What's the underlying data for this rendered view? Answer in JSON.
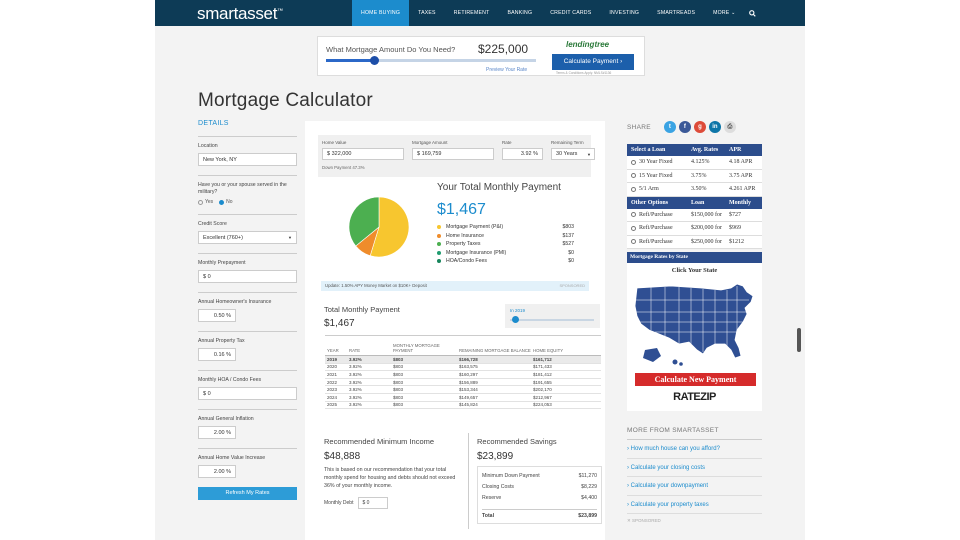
{
  "header": {
    "logo": "smartasset",
    "nav": [
      "HOME BUYING",
      "TAXES",
      "RETIREMENT",
      "BANKING",
      "CREDIT CARDS",
      "INVESTING",
      "SMARTREADS",
      "MORE ⌄"
    ],
    "active_nav": "HOME BUYING"
  },
  "ad": {
    "question": "What Mortgage Amount Do You Need?",
    "amount": "$225,000",
    "preview": "Preview Your Rate",
    "brand": "lendingtree",
    "button": "Calculate Payment ›",
    "fine_print": "Terms & Conditions Apply. NMLS#1136"
  },
  "page_title": "Mortgage Calculator",
  "sidebar": {
    "details": "DETAILS",
    "location_label": "Location",
    "location_value": "New York, NY",
    "military_label": "Have you or your spouse served in the military?",
    "military_yes": "Yes",
    "military_no": "No",
    "credit_label": "Credit Score",
    "credit_value": "Excellent (760+)",
    "prepay_label": "Monthly Prepayment",
    "prepay_value": "$ 0",
    "insurance_label": "Annual Homeowner's Insurance",
    "insurance_value": "0.50 %",
    "tax_label": "Annual Property Tax",
    "tax_value": "0.16 %",
    "hoa_label": "Monthly HOA / Condo Fees",
    "hoa_value": "$ 0",
    "inflation_label": "Annual General Inflation",
    "inflation_value": "2.00 %",
    "hvi_label": "Annual Home Value Increase",
    "hvi_value": "2.00 %",
    "refresh": "Refresh My Rates"
  },
  "inputs": {
    "home_value_label": "Home Value",
    "home_value": "$ 322,000",
    "mortgage_label": "Mortgage Amount",
    "mortgage": "$ 169,759",
    "rate_label": "Rate",
    "rate": "3.92 %",
    "term_label": "Remaining Term",
    "term": "30 Years",
    "down_payment": "Down Payment 47.3%"
  },
  "payment": {
    "title": "Your Total Monthly Payment",
    "amount": "$1,467",
    "breakdown": [
      {
        "label": "Mortgage Payment (P&I)",
        "value": "$803",
        "color": "#f7c62f"
      },
      {
        "label": "Home Insurance",
        "value": "$137",
        "color": "#ef8c2b"
      },
      {
        "label": "Property Taxes",
        "value": "$527",
        "color": "#4caf50"
      },
      {
        "label": "Mortgage Insurance (PMI)",
        "value": "$0",
        "color": "#1f9c6f"
      },
      {
        "label": "HOA/Condo Fees",
        "value": "$0",
        "color": "#17855c"
      }
    ],
    "update": "Update: 1.50% APY Money Market on $10K+ Deposit",
    "sponsored": "SPONSORED"
  },
  "amortization": {
    "label": "Total Monthly Payment",
    "amount": "$1,467",
    "year_label": "In 2019",
    "headers": [
      "YEAR",
      "RATE",
      "MONTHLY MORTGAGE PAYMENT",
      "REMAINING MORTGAGE BALANCE",
      "HOME EQUITY"
    ],
    "rows": [
      [
        "2019",
        "3.92%",
        "$803",
        "$166,728",
        "$161,712"
      ],
      [
        "2020",
        "3.92%",
        "$803",
        "$163,575",
        "$171,433"
      ],
      [
        "2021",
        "3.92%",
        "$803",
        "$160,297",
        "$181,412"
      ],
      [
        "2022",
        "3.92%",
        "$803",
        "$156,889",
        "$191,655"
      ],
      [
        "2023",
        "3.92%",
        "$803",
        "$153,344",
        "$202,170"
      ],
      [
        "2024",
        "3.92%",
        "$803",
        "$149,657",
        "$212,967"
      ],
      [
        "2025",
        "3.92%",
        "$803",
        "$145,824",
        "$224,053"
      ]
    ]
  },
  "income": {
    "title": "Recommended Minimum Income",
    "amount": "$48,888",
    "text": "This is based on our recommendation that your total monthly spend for housing and debts should not exceed 36% of your monthly income.",
    "debt_label": "Monthly Debt",
    "debt_value": "$ 0"
  },
  "savings": {
    "title": "Recommended Savings",
    "amount": "$23,899",
    "rows": [
      [
        "Minimum Down Payment",
        "$11,270"
      ],
      [
        "Closing Costs",
        "$8,229"
      ],
      [
        "Reserve",
        "$4,400"
      ]
    ],
    "total_label": "Total",
    "total": "$23,899"
  },
  "right": {
    "share": "SHARE",
    "loan_head": [
      "Select a Loan",
      "Avg. Rates",
      "APR"
    ],
    "loans": [
      [
        "30 Year Fixed",
        "4.125%",
        "4.18 APR"
      ],
      [
        "15 Year Fixed",
        "3.75%",
        "3.75 APR"
      ],
      [
        "5/1 Arm",
        "3.50%",
        "4.261 APR"
      ]
    ],
    "other_head": [
      "Other Options",
      "Loan",
      "Monthly"
    ],
    "others": [
      [
        "Refi/Purchase",
        "$150,000 for",
        "$727"
      ],
      [
        "Refi/Purchase",
        "$200,000 for",
        "$969"
      ],
      [
        "Refi/Purchase",
        "$250,000 for",
        "$1212"
      ]
    ],
    "map_head": "Mortgage Rates by State",
    "click_state": "Click Your State",
    "calc_new": "Calculate New Payment",
    "ratezip": "RATEZIP",
    "more_head": "MORE FROM SMARTASSET",
    "more_links": [
      "› How much house can you afford?",
      "› Calculate your closing costs",
      "› Calculate your downpayment",
      "› Calculate your property taxes"
    ],
    "sponsored": "✕ SPONSORED"
  }
}
